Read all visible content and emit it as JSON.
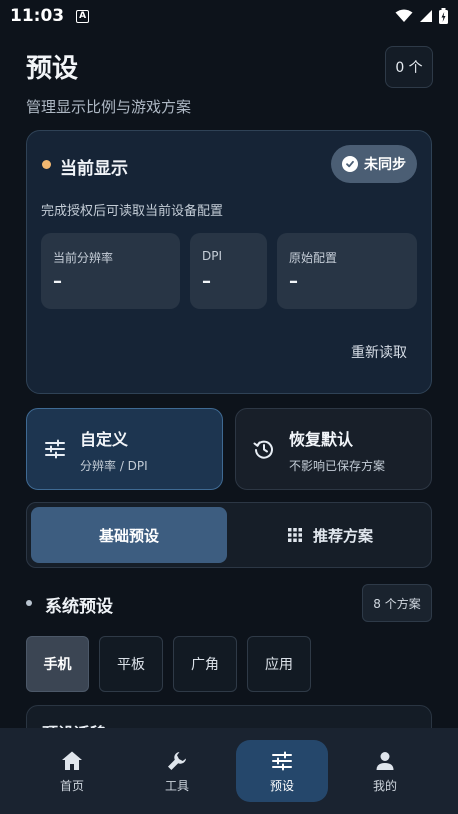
{
  "status_bar": {
    "time": "11:03",
    "notification_letter": "A"
  },
  "header": {
    "title": "预设",
    "subtitle": "管理显示比例与游戏方案",
    "count_badge": "0 个"
  },
  "display_card": {
    "title": "当前显示",
    "sync_status": "未同步",
    "note": "完成授权后可读取当前设备配置",
    "stats": [
      {
        "label": "当前分辨率",
        "value": "–"
      },
      {
        "label": "DPI",
        "value": "–"
      },
      {
        "label": "原始配置",
        "value": "–"
      }
    ],
    "reread_label": "重新读取",
    "accent_color": "#f2b871"
  },
  "actions": {
    "custom": {
      "title": "自定义",
      "subtitle": "分辨率 / DPI",
      "icon": "sliders-icon"
    },
    "restore": {
      "title": "恢复默认",
      "subtitle": "不影响已保存方案",
      "icon": "history-icon"
    }
  },
  "segments": {
    "active": "基础预设",
    "inactive": "推荐方案",
    "inactive_icon": "grid-icon"
  },
  "section": {
    "title": "系统预设",
    "count": "8 个方案"
  },
  "filters": [
    {
      "label": "手机",
      "active": true
    },
    {
      "label": "平板",
      "active": false
    },
    {
      "label": "广角",
      "active": false
    },
    {
      "label": "应用",
      "active": false
    }
  ],
  "peek_card": {
    "title": "预设迁移"
  },
  "bottom_nav": [
    {
      "label": "首页",
      "icon": "home-icon",
      "active": false
    },
    {
      "label": "工具",
      "icon": "wrench-icon",
      "active": false
    },
    {
      "label": "预设",
      "icon": "sliders-icon",
      "active": true
    },
    {
      "label": "我的",
      "icon": "person-icon",
      "active": false
    }
  ]
}
